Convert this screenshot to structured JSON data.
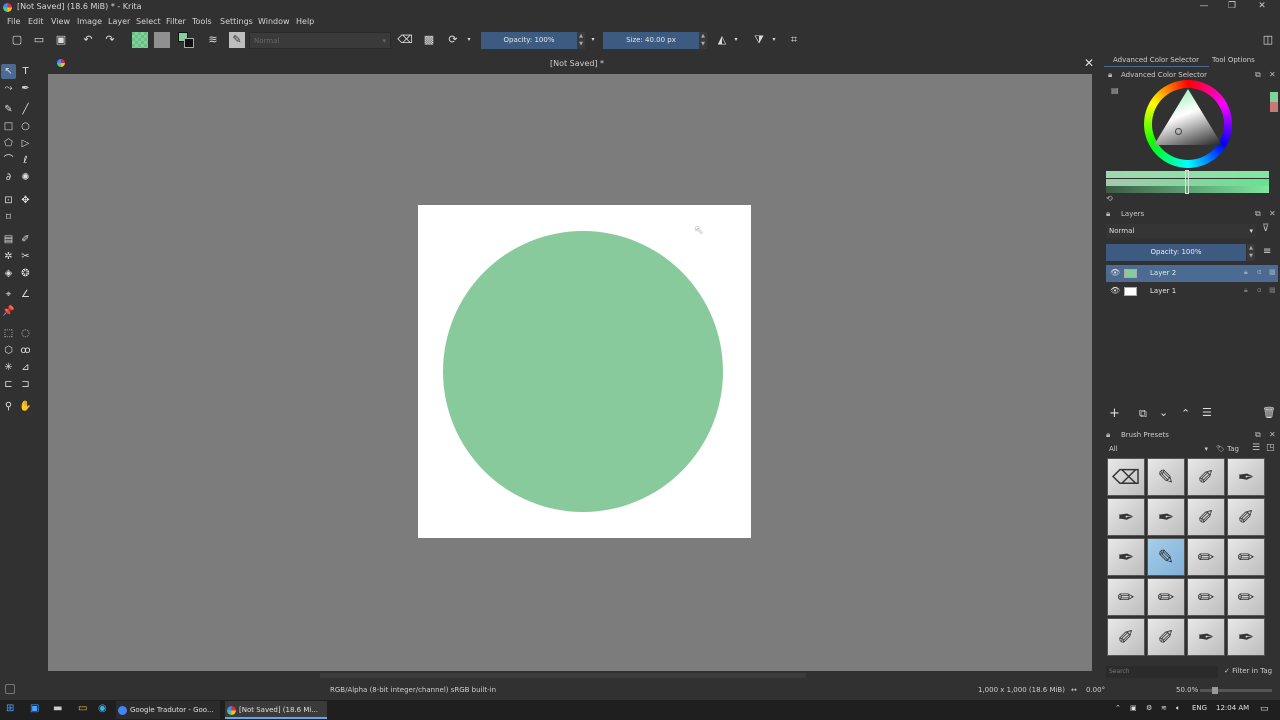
{
  "window": {
    "title": "[Not Saved]  (18.6 MiB)  * - Krita",
    "controls": [
      "—",
      "❐",
      "✕"
    ]
  },
  "menu": [
    "File",
    "Edit",
    "View",
    "Image",
    "Layer",
    "Select",
    "Filter",
    "Tools",
    "Settings",
    "Window",
    "Help"
  ],
  "toolbar": {
    "blend_mode": "Normal",
    "opacity": "Opacity: 100%",
    "size": "Size: 40.00 px"
  },
  "canvas": {
    "tab_title": "[Not Saved]  *",
    "circle_color": "#88ca9c",
    "background": "#7c7c7c"
  },
  "dock": {
    "tabs": [
      "Advanced Color Selector",
      "Tool Options"
    ],
    "color_selector_title": "Advanced Color Selector",
    "layers_title": "Layers",
    "layers_blend": "Normal",
    "layers_opacity": "Opacity: 100%",
    "layers": [
      {
        "name": "Layer 2",
        "selected": true,
        "thumb": "#88ca9c"
      },
      {
        "name": "Layer 1",
        "selected": false,
        "thumb": "#ffffff"
      }
    ],
    "brush_title": "Brush Presets",
    "brush_filter": "All",
    "brush_tag": "Tag",
    "search_placeholder": "Search",
    "filter_in_tag": "Filter in Tag"
  },
  "status": {
    "color_info": "RGB/Alpha (8-bit integer/channel)  sRGB built-in",
    "dimensions": "1,000 x 1,000 (18.6 MiB)",
    "rotation": "0.00°",
    "zoom": "50.0%"
  },
  "taskbar": {
    "items": [
      {
        "label": "Google Tradutor - Goo...",
        "color": "#4285f4"
      },
      {
        "label": "[Not Saved]  (18.6 Mi...",
        "color": "#e24a6d"
      }
    ],
    "lang": "ENG",
    "time": "12:04 AM"
  },
  "colors": {
    "accent": "#4b6b92",
    "slider": "#3d5a80",
    "fg_swatch": "#7fd39a",
    "bg_swatch": "#909090"
  }
}
